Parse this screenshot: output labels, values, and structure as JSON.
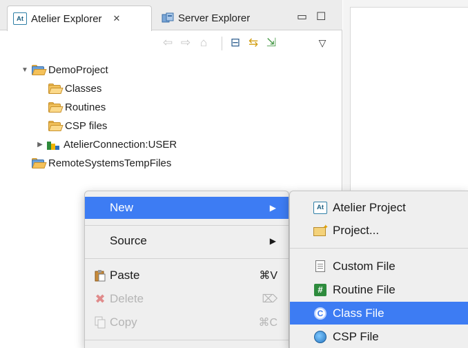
{
  "tabs": {
    "active": {
      "badge": "At",
      "label": "Atelier Explorer",
      "close": "✕"
    },
    "inactive": {
      "label": "Server Explorer"
    },
    "minimize": "▭",
    "maximize": "☐"
  },
  "toolbar": {
    "back": "⇦",
    "forward": "⇨",
    "home": "⌂",
    "collapse_all": "⊟",
    "link": "⇆",
    "import": "⇲",
    "view_menu": "▽"
  },
  "tree": [
    {
      "label": "DemoProject",
      "type": "project",
      "expanded": true
    },
    {
      "label": "Classes",
      "type": "folder"
    },
    {
      "label": "Routines",
      "type": "folder"
    },
    {
      "label": "CSP files",
      "type": "folder"
    },
    {
      "label": "AtelierConnection:USER",
      "type": "connection",
      "expanded": false
    },
    {
      "label": "RemoteSystemsTempFiles",
      "type": "project"
    }
  ],
  "context_menu": {
    "new": {
      "label": "New",
      "arrow": "▶"
    },
    "source": {
      "label": "Source",
      "arrow": "▶"
    },
    "paste": {
      "label": "Paste",
      "shortcut": "⌘V"
    },
    "delete": {
      "label": "Delete",
      "shortcut": "⌦"
    },
    "copy": {
      "label": "Copy",
      "shortcut": "⌘C"
    }
  },
  "submenu": {
    "atelier_project": {
      "badge": "At",
      "label": "Atelier Project"
    },
    "project": {
      "label": "Project..."
    },
    "custom_file": {
      "label": "Custom File"
    },
    "routine_file": {
      "icon": "#",
      "label": "Routine File"
    },
    "class_file": {
      "icon": "C",
      "label": "Class File"
    },
    "csp_file": {
      "label": "CSP File"
    }
  },
  "colors": {
    "highlight": "#3d7cf3",
    "menu_bg": "#efefef",
    "routine_green": "#2e8b3d"
  }
}
